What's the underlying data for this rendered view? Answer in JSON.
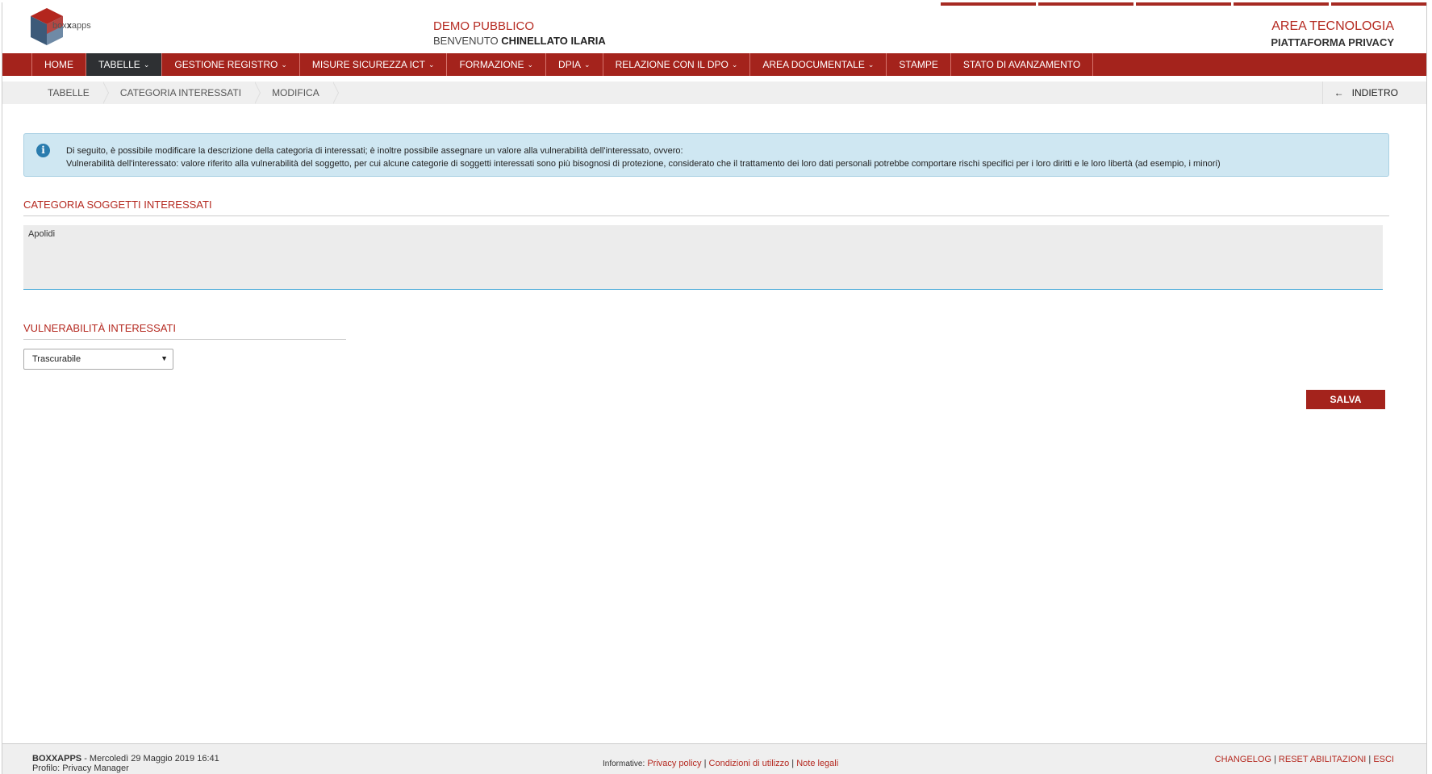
{
  "header": {
    "logo_text_pre": "box",
    "logo_text_bold": "x",
    "logo_text_post": "apps",
    "demo": "DEMO PUBBLICO",
    "welcome_label": "BENVENUTO",
    "user_name": "CHINELLATO ILARIA",
    "area": "AREA TECNOLOGIA",
    "platform": "PIATTAFORMA PRIVACY"
  },
  "nav": {
    "items": [
      {
        "label": "HOME",
        "dropdown": false
      },
      {
        "label": "TABELLE",
        "dropdown": true,
        "active": true
      },
      {
        "label": "GESTIONE REGISTRO",
        "dropdown": true
      },
      {
        "label": "MISURE SICUREZZA ICT",
        "dropdown": true
      },
      {
        "label": "FORMAZIONE",
        "dropdown": true
      },
      {
        "label": "DPIA",
        "dropdown": true
      },
      {
        "label": "RELAZIONE CON IL DPO",
        "dropdown": true
      },
      {
        "label": "AREA DOCUMENTALE",
        "dropdown": true
      },
      {
        "label": "STAMPE",
        "dropdown": false
      },
      {
        "label": "STATO DI AVANZAMENTO",
        "dropdown": false
      }
    ]
  },
  "breadcrumb": {
    "items": [
      "TABELLE",
      "CATEGORIA INTERESSATI",
      "MODIFICA"
    ],
    "back_label": "INDIETRO"
  },
  "info": {
    "line1": "Di seguito, è possibile modificare la descrizione della categoria di interessati; è inoltre possibile assegnare un valore alla vulnerabilità dell'interessato, ovvero:",
    "line2": "Vulnerabilità dell'interessato: valore riferito alla vulnerabilità del soggetto, per cui alcune categorie di soggetti interessati sono più bisognosi di protezione, considerato che il trattamento dei loro dati personali potrebbe comportare rischi specifici per i loro diritti e le loro libertà (ad esempio, i minori)"
  },
  "form": {
    "category_title": "CATEGORIA SOGGETTI INTERESSATI",
    "category_value": "Apolidi",
    "vulnerability_title": "VULNERABILITÀ INTERESSATI",
    "vulnerability_selected": "Trascurabile",
    "save_label": "SALVA"
  },
  "footer": {
    "brand": "BOXXAPPS",
    "datetime": " - Mercoledì 29 Maggio 2019 16:41",
    "profile": "Profilo: Privacy Manager",
    "informative_label": "Informative:",
    "privacy": "Privacy policy",
    "conditions": "Condizioni di utilizzo",
    "legal": "Note legali",
    "changelog": "CHANGELOG",
    "reset": "RESET ABILITAZIONI",
    "exit": "ESCI"
  },
  "colors": {
    "brand_red": "#a4231c",
    "nav_active": "#2e3033",
    "info_bg": "#cfe7f2"
  }
}
